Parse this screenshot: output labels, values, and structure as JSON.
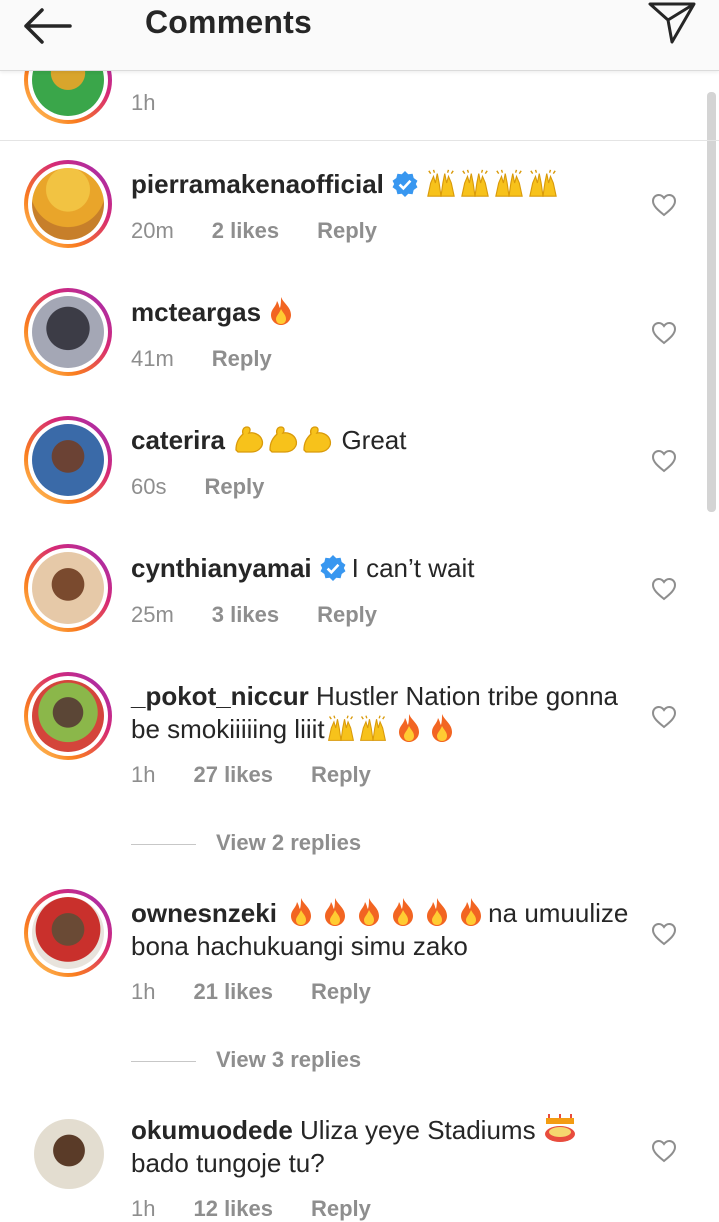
{
  "header": {
    "title": "Comments"
  },
  "partial_comment": {
    "time": "1h"
  },
  "comments": [
    {
      "user": "pierramakenaofficial",
      "verified": true,
      "text": "",
      "time": "20m",
      "likes": "2 likes",
      "reply": "Reply"
    },
    {
      "user": "mcteargas",
      "verified": false,
      "text": "",
      "time": "41m",
      "likes": "",
      "reply": "Reply"
    },
    {
      "user": "caterira",
      "verified": false,
      "text": "Great",
      "time": "60s",
      "likes": "",
      "reply": "Reply"
    },
    {
      "user": "cynthianyamai",
      "verified": true,
      "text": "I can’t wait",
      "time": "25m",
      "likes": "3 likes",
      "reply": "Reply"
    },
    {
      "user": "_pokot_niccur",
      "verified": false,
      "text": "Hustler Nation tribe gonna be smokiiiiing liiit",
      "time": "1h",
      "likes": "27 likes",
      "reply": "Reply",
      "view_replies": "View 2 replies"
    },
    {
      "user": "ownesnzeki",
      "verified": false,
      "text": "na umuulize bona hachukuangi simu zako",
      "time": "1h",
      "likes": "21 likes",
      "reply": "Reply",
      "view_replies": "View 3 replies"
    },
    {
      "user": "okumuodede",
      "verified": false,
      "text": "Uliza yeye Stadiums",
      "text2": "bado tungoje tu?",
      "time": "1h",
      "likes": "12 likes",
      "reply": "Reply"
    }
  ],
  "icons": {
    "back": "arrow-left-icon",
    "send": "paper-plane-icon",
    "like": "heart-outline-icon",
    "verified": "verified-badge-icon",
    "emoji_hands": "raising-hands-emoji",
    "emoji_fire": "fire-emoji",
    "emoji_muscle": "flexed-biceps-emoji",
    "emoji_stadium": "stadium-emoji"
  },
  "colors": {
    "verified": "#3897f0",
    "meta": "#8e8e8e",
    "text": "#262626"
  }
}
